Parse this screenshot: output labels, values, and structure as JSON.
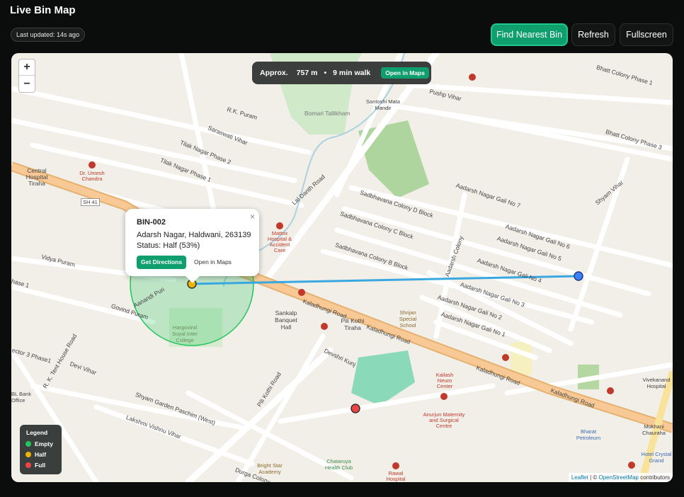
{
  "header": {
    "title": "Live Bin Map",
    "last_updated": "Last updated: 14s ago",
    "find_nearest_label": "Find Nearest Bin",
    "refresh_label": "Refresh",
    "fullscreen_label": "Fullscreen"
  },
  "map": {
    "zoom_in": "+",
    "zoom_out": "−",
    "walk_info": {
      "approx": "Approx.",
      "distance": "757 m",
      "separator": "•",
      "duration": "9 min walk",
      "open_label": "Open in Maps"
    },
    "popup": {
      "bin_id": "BIN-002",
      "address": "Adarsh Nagar, Haldwani, 263139",
      "status": "Status: Half (53%)",
      "directions_label": "Get Directions",
      "open_label": "Open in Maps",
      "close": "×"
    },
    "legend": {
      "title": "Legend",
      "items": [
        {
          "label": "Empty",
          "color": "#22c55e"
        },
        {
          "label": "Half",
          "color": "#eab308"
        },
        {
          "label": "Full",
          "color": "#ef4444"
        }
      ]
    },
    "attribution": {
      "leaflet": "Leaflet",
      "sep": " | © ",
      "osm": "OpenStreetMap",
      "suffix": " contributors"
    },
    "street_labels": {
      "bhatt1": "Bhatt Colony Phase 1",
      "bhatt3": "Bhatt Colony Phase 3",
      "pushp": "Pushp Vihar",
      "rkpuram": "R.K. Puram",
      "saraswati": "Saraswati Vihar",
      "tilak2": "Tilak Nagar Phase 2",
      "tilak1": "Tilak Nagar Phase 1",
      "central": "Central Hospital Tiraha",
      "sh41": "SH 41",
      "laldanth": "Lal Danth Road",
      "sadbD": "Sadbhavana Colony D Block",
      "sadbC": "Sadbhavana Colony C Block",
      "sadbB": "Sadbhavana Colony B Block",
      "gali7": "Aadarsh Nagar Gali No 7",
      "gali6": "Aadarsh Nagar Gali No 6",
      "gali5": "Aadarsh Nagar Gali No 5",
      "gali4": "Aadarsh Nagar Gali No 4",
      "gali3": "Aadarsh Nagar Gali No 3",
      "gali2": "Aadarsh Nagar Gali No 2",
      "gali1": "Aadarsh Nagar Gali No 1",
      "shyam": "Shyam Vihar",
      "vidya": "Vidya Puram",
      "aanandi": "Aanandi Puri",
      "govind": "Govind Puram",
      "kaladhungi1": "Kaladhungi Road",
      "kaladhungi2": "Kaladhungi Road",
      "kaladhungi3": "Kaladhungi Road",
      "kaladhungi4": "Kaladhungi Road",
      "pilikothi": "Pili Kothi Road",
      "devshri": "Devshri Kunj",
      "devi": "Devi Vihar",
      "shyamgarden": "Shyam Garden Paschim (West)",
      "lakshmi": "Lakshmi Vishnu Vihar",
      "durga": "Durga Colony",
      "rktent": "R. K. Tent House Road",
      "aadarshcolony": "Aadarsh Colony",
      "bomari": "Bomari Tallikham",
      "santoshi": "Santoshi Mata Mandir",
      "sankalp": "Sankalp Banquet Hall",
      "pilitiraha": "Pili Kothi Tiraha",
      "hargovind": "Hargovind Suyal Inter College",
      "shrijan": "Shrijan Special School",
      "bright": "Bright Star Academy",
      "chataruya": "Chataruya Health Club",
      "bharat": "Bharat Petroleum",
      "hotel": "Hotel Crystal Grand",
      "mukhani": "Mukhani Chauraha",
      "vivekanand": "Vivekanand Hospital",
      "blbank": "BL Bank Office",
      "sector": "ector 3 Phase1",
      "hase": "hase 1"
    },
    "hospital_labels": {
      "umesh": "Dr. Umesh Chandra",
      "mattrix": "Mattrix Hospital & Accident Care",
      "kailash": "Kailash Neuro Center",
      "anurjun": "Anurjun Maternity and Surgical Centre",
      "rawal": "Rawal Hospital"
    }
  },
  "colors": {
    "accent": "#0f9f6e",
    "route": "#3aa8e0",
    "radius": "#22c55e",
    "full_marker": "#ef4444",
    "user_marker": "#3b82f6"
  }
}
